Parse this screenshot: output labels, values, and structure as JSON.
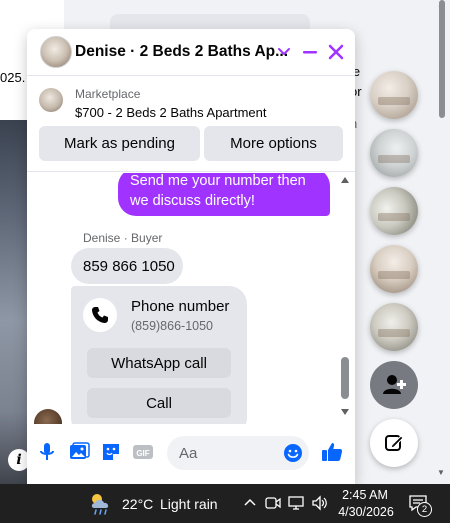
{
  "background": {
    "left_text": "025.",
    "right_text_lines": [
      "le",
      "or"
    ],
    "right_text_note": "n",
    "info_button": "i"
  },
  "chat": {
    "title": "Denise · 2 Beds 2 Baths Ap...",
    "listing": {
      "source": "Marketplace",
      "title": "$700 - 2 Beds 2 Baths Apartment"
    },
    "actions": {
      "mark_pending": "Mark as pending",
      "more_options": "More options"
    },
    "messages": {
      "outgoing_text": "Send me your number then we discuss directly!",
      "sender_label": "Denise · Buyer",
      "incoming_text": "859 866 1050",
      "contact_card": {
        "title": "Phone number",
        "number": "(859)866-1050",
        "whatsapp_label": "WhatsApp call",
        "call_label": "Call"
      }
    },
    "composer": {
      "placeholder": "Aa",
      "icons": [
        "microphone-icon",
        "photo-icon",
        "sticker-icon",
        "gif-icon",
        "emoji-icon",
        "like-icon"
      ]
    },
    "accent_color": "#a033ff",
    "icon_color": "#0866ff"
  },
  "chat_heads": {
    "count": 5,
    "more_icon": "add-person-icon",
    "new_message_icon": "compose-icon"
  },
  "taskbar": {
    "temperature": "22°C",
    "condition": "Light rain",
    "time": "2:45 AM",
    "date": "4/30/2026",
    "notification_count": "2"
  }
}
